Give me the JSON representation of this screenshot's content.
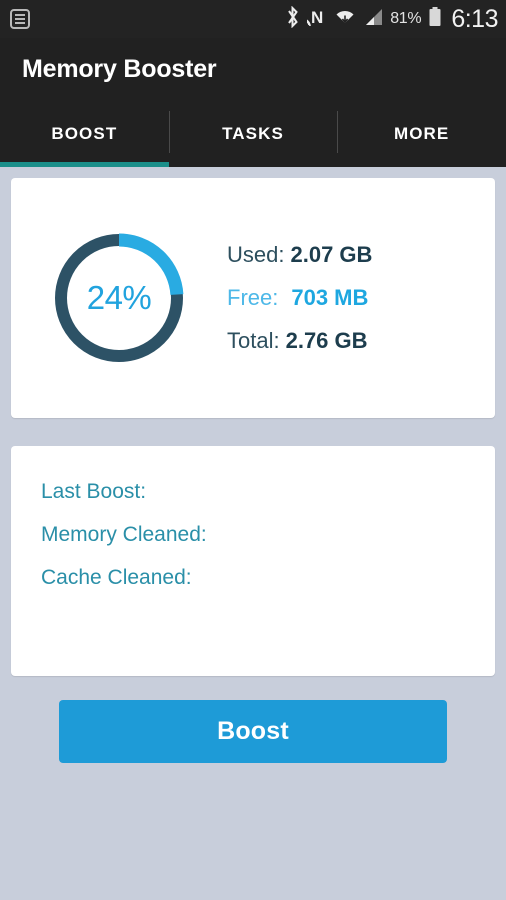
{
  "status_bar": {
    "notification_icon": "notification-list-icon",
    "icons": [
      "bluetooth-icon",
      "nfc-icon",
      "wifi-icon",
      "cellular-signal-icon"
    ],
    "battery_percent": "81%",
    "battery_icon": "battery-icon",
    "time": "6:13"
  },
  "app": {
    "title": "Memory Booster"
  },
  "tabs": {
    "active_index": 0,
    "items": [
      {
        "label": "BOOST"
      },
      {
        "label": "TASKS"
      },
      {
        "label": "MORE"
      }
    ]
  },
  "memory_card": {
    "percent_label": "24%",
    "percent_value": 24,
    "stats": [
      {
        "label": "Used:",
        "value": "2.07 GB",
        "accent": false
      },
      {
        "label": "Free:",
        "value": "703 MB",
        "accent": true
      },
      {
        "label": "Total:",
        "value": "2.76 GB",
        "accent": false
      }
    ]
  },
  "boost_info_card": {
    "rows": [
      {
        "label": "Last Boost:",
        "value": ""
      },
      {
        "label": "Memory Cleaned:",
        "value": ""
      },
      {
        "label": "Cache Cleaned:",
        "value": ""
      }
    ]
  },
  "actions": {
    "boost_label": "Boost"
  },
  "colors": {
    "accent_blue": "#1e9bd7",
    "donut_arc": "#29abe2",
    "donut_track": "#2d5266",
    "tab_indicator": "#1b8f8a",
    "page_background": "#c8cedb",
    "appbar": "#212121"
  }
}
